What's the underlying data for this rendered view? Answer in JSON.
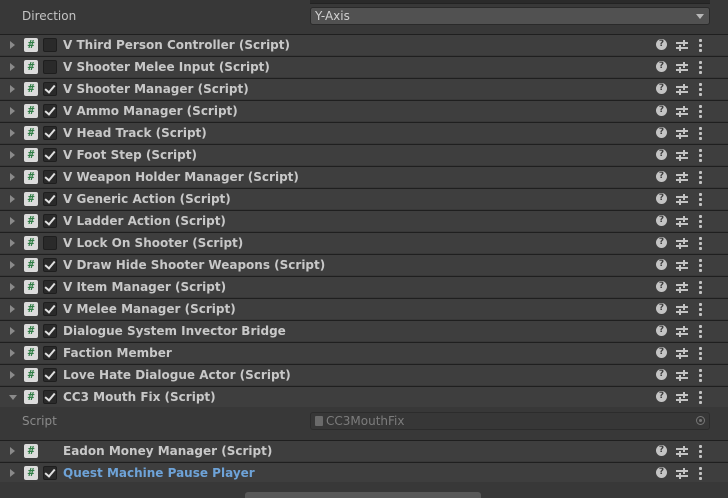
{
  "property": {
    "label": "Direction",
    "value": "Y-Axis"
  },
  "components": [
    {
      "title": "V Third Person Controller (Script)",
      "enabled": false,
      "has_toggle": true,
      "expanded": false,
      "link": false
    },
    {
      "title": "V Shooter Melee Input (Script)",
      "enabled": false,
      "has_toggle": true,
      "expanded": false,
      "link": false
    },
    {
      "title": "V Shooter Manager (Script)",
      "enabled": true,
      "has_toggle": true,
      "expanded": false,
      "link": false
    },
    {
      "title": "V Ammo Manager (Script)",
      "enabled": true,
      "has_toggle": true,
      "expanded": false,
      "link": false
    },
    {
      "title": "V Head Track (Script)",
      "enabled": true,
      "has_toggle": true,
      "expanded": false,
      "link": false
    },
    {
      "title": "V Foot Step (Script)",
      "enabled": true,
      "has_toggle": true,
      "expanded": false,
      "link": false
    },
    {
      "title": "V Weapon Holder Manager (Script)",
      "enabled": true,
      "has_toggle": true,
      "expanded": false,
      "link": false
    },
    {
      "title": "V Generic Action (Script)",
      "enabled": true,
      "has_toggle": true,
      "expanded": false,
      "link": false
    },
    {
      "title": "V Ladder Action (Script)",
      "enabled": true,
      "has_toggle": true,
      "expanded": false,
      "link": false
    },
    {
      "title": "V Lock On Shooter (Script)",
      "enabled": false,
      "has_toggle": true,
      "expanded": false,
      "link": false
    },
    {
      "title": "V Draw Hide Shooter Weapons (Script)",
      "enabled": true,
      "has_toggle": true,
      "expanded": false,
      "link": false
    },
    {
      "title": "V Item Manager (Script)",
      "enabled": true,
      "has_toggle": true,
      "expanded": false,
      "link": false
    },
    {
      "title": "V Melee Manager (Script)",
      "enabled": true,
      "has_toggle": true,
      "expanded": false,
      "link": false
    },
    {
      "title": "Dialogue System Invector Bridge",
      "enabled": true,
      "has_toggle": true,
      "expanded": false,
      "link": false
    },
    {
      "title": "Faction Member",
      "enabled": true,
      "has_toggle": true,
      "expanded": false,
      "link": false
    },
    {
      "title": "Love Hate Dialogue Actor (Script)",
      "enabled": true,
      "has_toggle": true,
      "expanded": false,
      "link": false
    },
    {
      "title": "CC3 Mouth Fix (Script)",
      "enabled": true,
      "has_toggle": true,
      "expanded": true,
      "link": false
    },
    {
      "title": "Eadon Money Manager (Script)",
      "enabled": false,
      "has_toggle": false,
      "expanded": false,
      "link": false
    },
    {
      "title": "Quest Machine Pause Player",
      "enabled": true,
      "has_toggle": true,
      "expanded": false,
      "link": true
    }
  ],
  "script_field": {
    "label": "Script",
    "value": "CC3MouthFix"
  },
  "icons": {
    "script": "#",
    "help": "?"
  },
  "colors": {
    "background": "#383838",
    "header": "#3e3e3e",
    "link": "#6ea3d8"
  }
}
